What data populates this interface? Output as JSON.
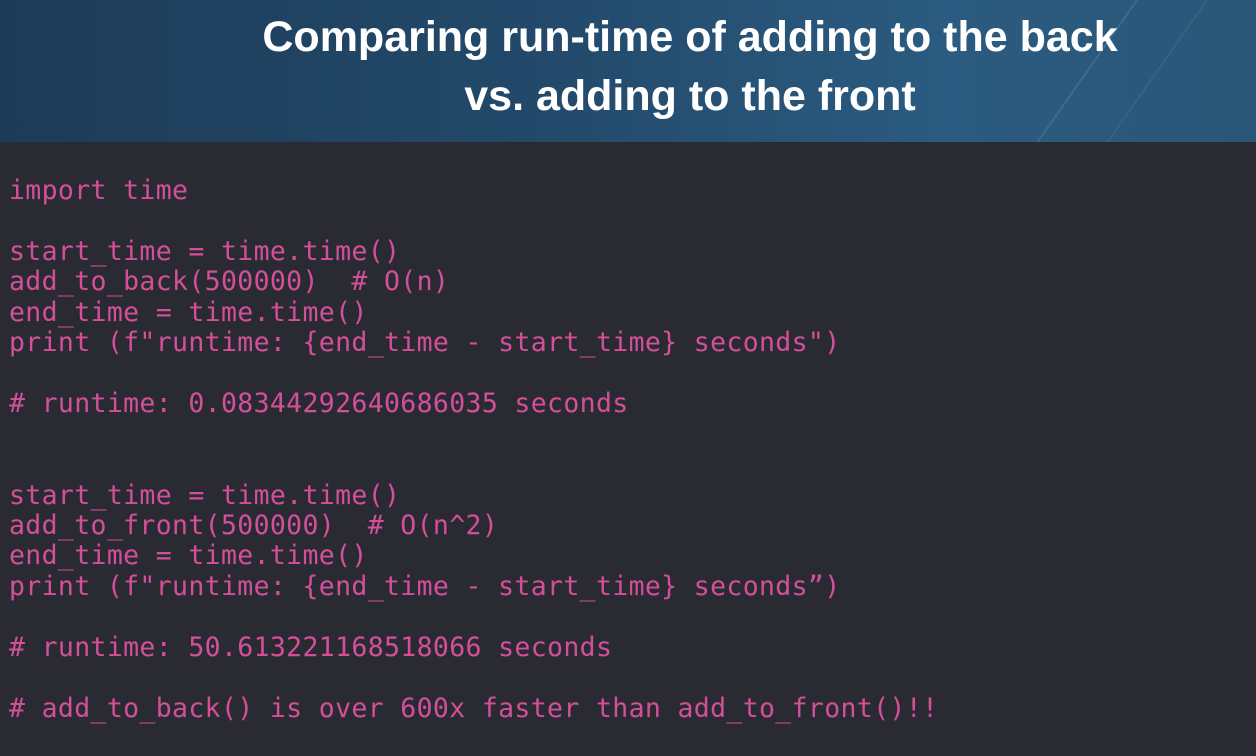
{
  "header": {
    "title_line1": "Comparing run-time of adding to the back",
    "title_line2": "vs. adding to the front"
  },
  "code": {
    "color": "#d34f9a",
    "lines": [
      "import time",
      "start_time = time.time()",
      "add_to_back(500000)  # O(n)",
      "end_time = time.time()",
      "print (f\"runtime: {end_time - start_time} seconds\")",
      "# runtime: 0.08344292640686035 seconds",
      "start_time = time.time()",
      "add_to_front(500000)  # O(n^2)",
      "end_time = time.time()",
      "print (f\"runtime: {end_time - start_time} seconds”)",
      "# runtime: 50.613221168518066 seconds",
      "# add_to_back() is over 600x faster than add_to_front()!!"
    ]
  }
}
